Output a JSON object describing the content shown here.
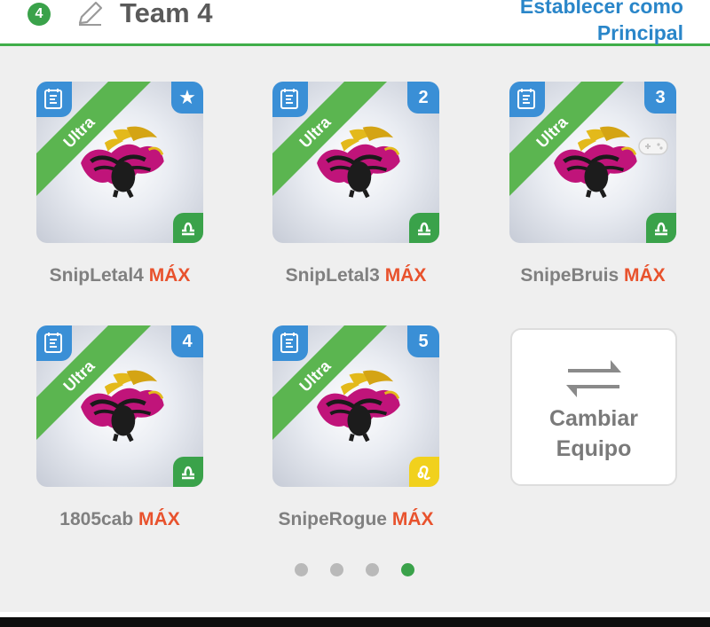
{
  "header": {
    "team_number": "4",
    "team_name": "Team 4",
    "set_main_line1": "Establecer como",
    "set_main_line2": "Principal",
    "edit_icon": "pencil-icon"
  },
  "cards": [
    {
      "name": "SnipLetal4",
      "level": "MÁX",
      "rarity": "Ultra",
      "badge": "★",
      "element": "libra-icon",
      "element_color": "#3aa24a"
    },
    {
      "name": "SnipLetal3",
      "level": "MÁX",
      "rarity": "Ultra",
      "badge": "2",
      "element": "libra-icon",
      "element_color": "#3aa24a"
    },
    {
      "name": "SnipeBruis",
      "level": "MÁX",
      "rarity": "Ultra",
      "badge": "3",
      "element": "libra-icon",
      "element_color": "#3aa24a",
      "extra_icon": "gamepad-icon"
    },
    {
      "name": "1805cab",
      "level": "MÁX",
      "rarity": "Ultra",
      "badge": "4",
      "element": "libra-icon",
      "element_color": "#3aa24a"
    },
    {
      "name": "SnipeRogue",
      "level": "MÁX",
      "rarity": "Ultra",
      "badge": "5",
      "element": "leo-icon",
      "element_color": "#f1d11d"
    }
  ],
  "switch_team": {
    "line1": "Cambiar",
    "line2": "Equipo",
    "icon": "swap-arrows-icon"
  },
  "pagination": {
    "total": 4,
    "active": 4,
    "active_color": "#3aa24a",
    "inactive_color": "#b9b9b9"
  },
  "colors": {
    "accent_green": "#3fae49",
    "link_blue": "#2a86c9",
    "max_orange": "#e8522d",
    "ultra_green": "#5bb550",
    "corner_blue": "#3a8fd6"
  }
}
